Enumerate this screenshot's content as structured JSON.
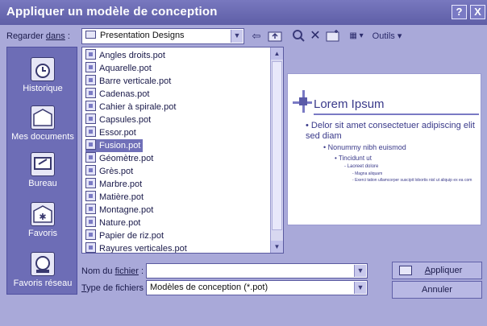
{
  "window": {
    "title": "Appliquer un modèle de conception",
    "help_label": "?",
    "close_label": "X"
  },
  "toolbar": {
    "look_in_label": "Regarder ",
    "look_in_underlined": "dans",
    "look_in_suffix": " :",
    "look_in_value": "Presentation Designs",
    "tools_label": "Outils",
    "icons": [
      "back-icon",
      "up-folder-icon",
      "search-web-icon",
      "delete-icon",
      "new-folder-icon",
      "views-icon",
      "tools-icon"
    ]
  },
  "places": [
    {
      "label": "Historique",
      "icon": "history-icon"
    },
    {
      "label": "Mes documents",
      "icon": "my-documents-icon"
    },
    {
      "label": "Bureau",
      "icon": "desktop-icon"
    },
    {
      "label": "Favoris",
      "icon": "favorites-icon"
    },
    {
      "label": "Favoris réseau",
      "icon": "network-favorites-icon"
    }
  ],
  "files": [
    "Angles droits.pot",
    "Aquarelle.pot",
    "Barre verticale.pot",
    "Cadenas.pot",
    "Cahier à spirale.pot",
    "Capsules.pot",
    "Essor.pot",
    "Fusion.pot",
    "Géomètre.pot",
    "Grès.pot",
    "Marbre.pot",
    "Matière.pot",
    "Montagne.pot",
    "Nature.pot",
    "Papier de riz.pot",
    "Rayures verticales.pot"
  ],
  "selected_file": "Fusion.pot",
  "preview": {
    "title": "Lorem Ipsum",
    "bullet1": "Delor sit amet consectetuer adipiscing elit sed diam",
    "bullet2": "Nonummy nibh euismod",
    "bullet3": "Tincidunt ut",
    "bullet4": "Laoreet dolore",
    "bullet5": "Magna aliquam",
    "bullet6": "Exerci tation ullamcorper suscipit lobortis nisl ut aliquip ex ea com"
  },
  "bottom": {
    "filename_label": "Nom du ",
    "filename_underlined": "fichier",
    "filename_suffix": " :",
    "filename_value": "",
    "filetype_underlined": "T",
    "filetype_label": "ype de fichiers :",
    "filetype_value": "Modèles de conception (*.pot)",
    "apply_underlined": "A",
    "apply_label": "ppliquer",
    "cancel_label": "Annuler"
  },
  "colors": {
    "titlebar": "#6b6bb3",
    "window_bg": "#a9a9d9",
    "places_bg": "#6d6db6",
    "selection": "#7070b8",
    "preview_text": "#3a3a8a"
  }
}
